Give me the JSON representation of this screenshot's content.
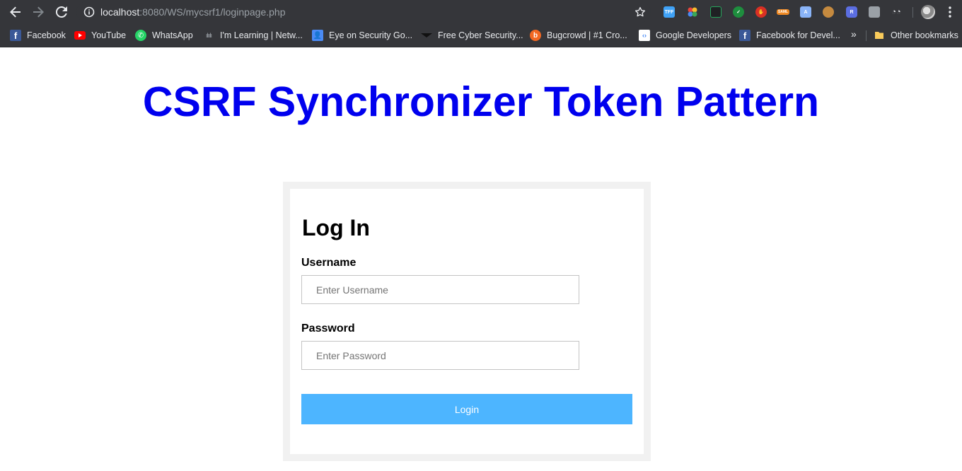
{
  "browser": {
    "url_host": "localhost",
    "url_rest": ":8080/WS/mycsrf1/loginpage.php",
    "extensions": [
      {
        "name": "tff-extension-icon",
        "label": "TFF",
        "color": "#3fa2f7"
      },
      {
        "name": "multicolor-extension-icon",
        "label": "",
        "color": "#e8453c"
      },
      {
        "name": "chart-extension-icon",
        "label": "",
        "color": "#26a65b"
      },
      {
        "name": "check-extension-icon",
        "label": "",
        "color": "#1e8e3e"
      },
      {
        "name": "stop-hand-extension-icon",
        "label": "",
        "color": "#d93025"
      },
      {
        "name": "sambl-extension-icon",
        "label": "SAML",
        "color": "#f08a24"
      },
      {
        "name": "person-extension-icon",
        "label": "",
        "color": "#8ab4f8"
      },
      {
        "name": "cookie-extension-icon",
        "label": "",
        "color": "#c58a3f"
      },
      {
        "name": "r-extension-icon",
        "label": "R",
        "color": "#5b6ee1"
      },
      {
        "name": "printer-extension-icon",
        "label": "",
        "color": "#9aa0a6"
      },
      {
        "name": "spy-extension-icon",
        "label": "",
        "color": "#e8eaed"
      }
    ]
  },
  "bookmarks": {
    "items": [
      {
        "label": "Facebook"
      },
      {
        "label": "YouTube"
      },
      {
        "label": "WhatsApp"
      },
      {
        "label": "I'm Learning | Netw..."
      },
      {
        "label": "Eye on Security Go..."
      },
      {
        "label": "Free Cyber Security..."
      },
      {
        "label": "Bugcrowd | #1 Cro..."
      },
      {
        "label": "Google Developers"
      },
      {
        "label": "Facebook for Devel..."
      }
    ],
    "overflow": "»",
    "other": "Other bookmarks"
  },
  "page": {
    "title": "CSRF Synchronizer Token Pattern"
  },
  "login": {
    "heading": "Log In",
    "username_label": "Username",
    "username_placeholder": "Enter Username",
    "username_value": "",
    "password_label": "Password",
    "password_placeholder": "Enter Password",
    "password_value": "",
    "button_label": "Login"
  },
  "colors": {
    "title": "#0000ee",
    "button": "#4db5ff",
    "card_border": "#f1f1f1",
    "chrome": "#35363a"
  }
}
